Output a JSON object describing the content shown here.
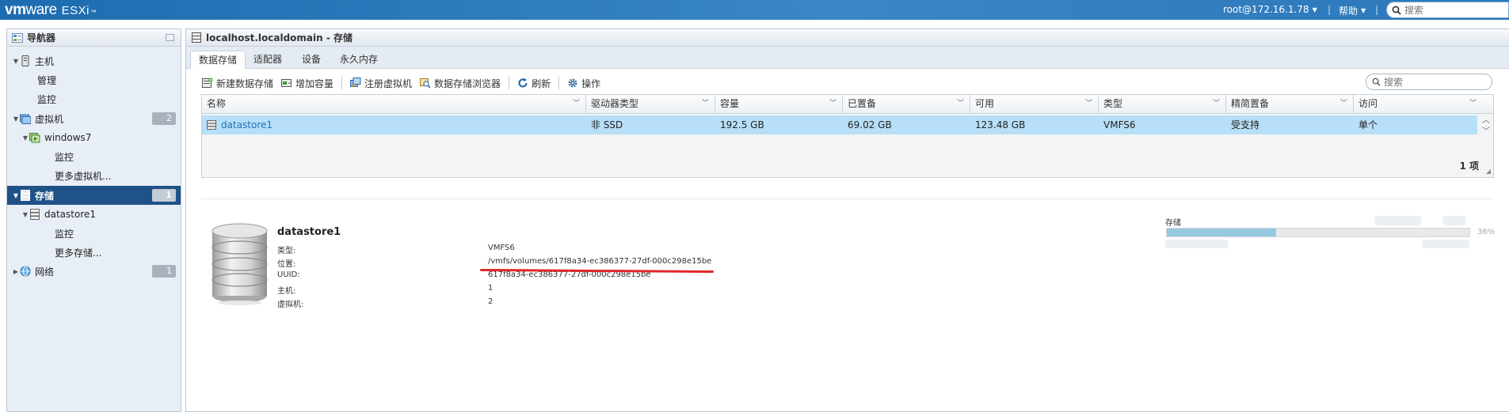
{
  "topbar": {
    "brand_vm": "vm",
    "brand_ware": "ware",
    "brand_esxi": "ESXi",
    "user": "root@172.16.1.78",
    "help": "帮助",
    "search_placeholder": "搜索"
  },
  "navigator": {
    "title": "导航器",
    "host": {
      "label": "主机",
      "children": [
        "管理",
        "监控"
      ]
    },
    "vms": {
      "label": "虚拟机",
      "count": "2",
      "vm_name": "windows7",
      "vm_child": "监控",
      "more": "更多虚拟机..."
    },
    "storage": {
      "label": "存储",
      "count": "1",
      "ds_name": "datastore1",
      "ds_child": "监控",
      "more": "更多存储..."
    },
    "network": {
      "label": "网络",
      "count": "1"
    }
  },
  "main": {
    "title": "localhost.localdomain - 存储",
    "tabs": [
      "数据存储",
      "适配器",
      "设备",
      "永久内存"
    ],
    "active_tab": "数据存储",
    "toolbar": {
      "new_datastore": "新建数据存储",
      "increase_capacity": "增加容量",
      "register_vm": "注册虚拟机",
      "datastore_browser": "数据存储浏览器",
      "refresh": "刷新",
      "actions": "操作"
    },
    "search_placeholder": "搜索",
    "grid": {
      "columns": [
        "名称",
        "驱动器类型",
        "容量",
        "已置备",
        "可用",
        "类型",
        "精简置备",
        "访问"
      ],
      "rows": [
        {
          "name": "datastore1",
          "drive_type": "非 SSD",
          "capacity": "192.5 GB",
          "provisioned": "69.02 GB",
          "free": "123.48 GB",
          "type": "VMFS6",
          "thin": "受支持",
          "access": "单个"
        }
      ],
      "count_label": "1 项"
    },
    "detail": {
      "name": "datastore1",
      "fields": [
        {
          "label": "类型:",
          "value": "VMFS6"
        },
        {
          "label": "位置:",
          "value": "/vmfs/volumes/617f8a34-ec386377-27df-000c298e15be"
        },
        {
          "label": "UUID:",
          "value": "617f8a34-ec386377-27df-000c298e15be"
        },
        {
          "label": "主机:",
          "value": "1"
        },
        {
          "label": "虚拟机:",
          "value": "2"
        }
      ],
      "storage_label": "存储",
      "storage_used_fraction": 0.36,
      "storage_pct": "36%"
    }
  },
  "colors": {
    "topbar": "#2b77ba",
    "selected_nav": "#1f5287",
    "selected_row": "#b7dff7",
    "link": "#1c74b9",
    "annotation": "#e0262b"
  }
}
